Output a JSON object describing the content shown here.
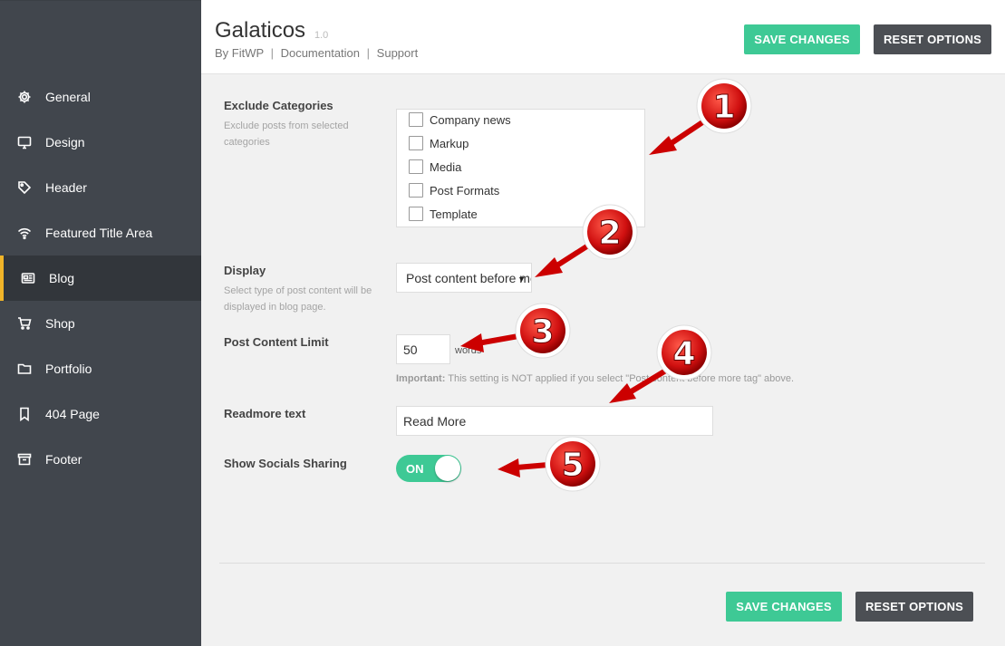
{
  "sidebar": {
    "items": [
      {
        "label": "General",
        "icon": "gear-icon"
      },
      {
        "label": "Design",
        "icon": "monitor-icon"
      },
      {
        "label": "Header",
        "icon": "tag-icon"
      },
      {
        "label": "Featured Title Area",
        "icon": "wifi-icon"
      },
      {
        "label": "Blog",
        "icon": "newspaper-icon"
      },
      {
        "label": "Shop",
        "icon": "cart-icon"
      },
      {
        "label": "Portfolio",
        "icon": "folder-icon"
      },
      {
        "label": "404 Page",
        "icon": "bookmark-icon"
      },
      {
        "label": "Footer",
        "icon": "archive-icon"
      }
    ],
    "active": "Blog"
  },
  "header": {
    "title": "Galaticos",
    "version": "1.0",
    "by": "By FitWP",
    "documentation": "Documentation",
    "support": "Support",
    "separator": "|",
    "save_label": "SAVE CHANGES",
    "reset_label": "RESET OPTIONS"
  },
  "fields": {
    "exclude_categories": {
      "label": "Exclude Categories",
      "desc": "Exclude posts from selected categories",
      "options": [
        "Company news",
        "Markup",
        "Media",
        "Post Formats",
        "Template"
      ]
    },
    "display": {
      "label": "Display",
      "desc": "Select type of post content will be displayed in blog page.",
      "value": "Post content before more tag"
    },
    "post_content_limit": {
      "label": "Post Content Limit",
      "value": "50",
      "unit": "words",
      "important_label": "Important:",
      "important_text": "This setting is NOT applied if you select \"Post content before more tag\" above."
    },
    "readmore": {
      "label": "Readmore text",
      "value": "Read More"
    },
    "socials": {
      "label": "Show Socials Sharing",
      "toggle_label": "ON",
      "state": true
    }
  },
  "footer": {
    "save_label": "SAVE CHANGES",
    "reset_label": "RESET OPTIONS"
  },
  "annotations": [
    "1",
    "2",
    "3",
    "4",
    "5"
  ],
  "colors": {
    "accent": "#3ec995",
    "sidebar": "#41464d",
    "active_indicator": "#f0b429",
    "annotation": "#d01010"
  }
}
